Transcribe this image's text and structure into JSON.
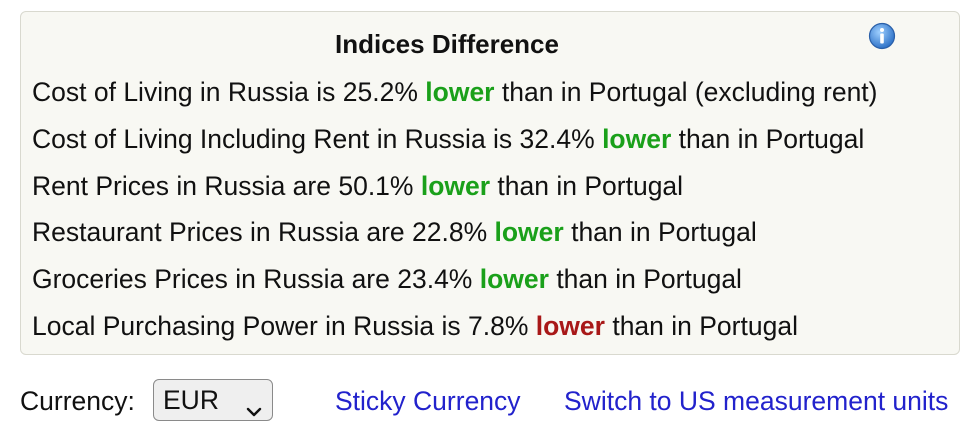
{
  "panel": {
    "title": "Indices Difference",
    "info_icon": "info-icon",
    "rows": [
      {
        "pre": "Cost of Living in Russia is 25.2% ",
        "word": "lower",
        "post": " than in Portugal (excluding rent)",
        "color": "#1aa01a"
      },
      {
        "pre": "Cost of Living Including Rent in Russia is 32.4% ",
        "word": "lower",
        "post": " than in Portugal",
        "color": "#1aa01a"
      },
      {
        "pre": "Rent Prices in Russia are 50.1% ",
        "word": "lower",
        "post": " than in Portugal",
        "color": "#1aa01a"
      },
      {
        "pre": "Restaurant Prices in Russia are 22.8% ",
        "word": "lower",
        "post": " than in Portugal",
        "color": "#1aa01a"
      },
      {
        "pre": "Groceries Prices in Russia are 23.4% ",
        "word": "lower",
        "post": " than in Portugal",
        "color": "#1aa01a"
      },
      {
        "pre": "Local Purchasing Power in Russia is 7.8% ",
        "word": "lower",
        "post": " than in Portugal",
        "color": "#a81818"
      }
    ]
  },
  "footer": {
    "currency_label": "Currency:",
    "currency_value": "EUR",
    "sticky_link": "Sticky Currency",
    "units_link": "Switch to US measurement units"
  },
  "colors": {
    "green": "#1aa01a",
    "red": "#a81818",
    "link": "#2222cc",
    "panel_bg": "#f8f8f3"
  }
}
